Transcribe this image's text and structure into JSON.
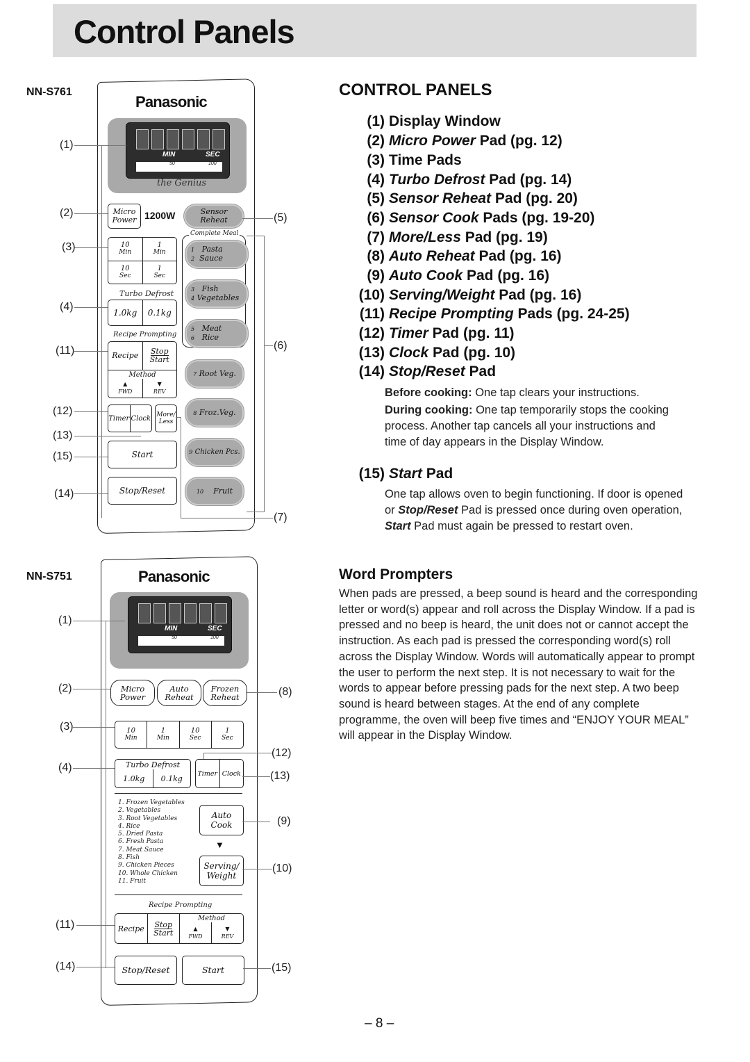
{
  "page": {
    "title": "Control Panels",
    "page_number": "– 8 –"
  },
  "panel_s761": {
    "model": "NN-S761",
    "brand": "Panasonic",
    "display": {
      "min_label": "MIN",
      "sec_label": "SEC",
      "pct_50": "50",
      "pct_100": "100",
      "pct_sign": "%",
      "logo": "the Genius"
    },
    "micro_power": [
      "Micro",
      "Power"
    ],
    "wattage": "1200W",
    "sensor_reheat": [
      "Sensor",
      "Reheat"
    ],
    "complete_meal_label": "Complete Meal",
    "time_pads": [
      [
        "10",
        "Min"
      ],
      [
        "1",
        "Min"
      ],
      [
        "10",
        "Sec"
      ],
      [
        "1",
        "Sec"
      ]
    ],
    "turbo_defrost_label": "Turbo Defrost",
    "turbo_defrost": [
      "1.0kg",
      "0.1kg"
    ],
    "recipe_prompting_label": "Recipe Prompting",
    "recipe": "Recipe",
    "stop": "Stop",
    "start_small": "Start",
    "method": "Method",
    "fwd": "FWD",
    "rev": "REV",
    "timer": "Timer",
    "clock": "Clock",
    "more_less": [
      "More/",
      "Less"
    ],
    "start": "Start",
    "stop_reset": "Stop/Reset",
    "sensor_cook_pads": [
      {
        "n1": "1",
        "l1": "Pasta",
        "n2": "2",
        "l2": "Sauce"
      },
      {
        "n1": "3",
        "l1": "Fish",
        "n2": "4",
        "l2": "Vegetables"
      },
      {
        "n1": "5",
        "l1": "Meat",
        "n2": "6",
        "l2": "Rice"
      },
      {
        "n1": "7",
        "l1": "Root Veg."
      },
      {
        "n1": "8",
        "l1": "Froz.Veg."
      },
      {
        "n1": "9",
        "l1": "Chicken Pcs."
      },
      {
        "n1": "10",
        "l1": "Fruit"
      }
    ],
    "callouts_left": [
      "(1)",
      "(2)",
      "(3)",
      "(4)",
      "(11)",
      "(12)",
      "(13)",
      "(15)",
      "(14)"
    ],
    "callouts_right": [
      "(5)",
      "(6)",
      "(7)"
    ]
  },
  "panel_s751": {
    "model": "NN-S751",
    "brand": "Panasonic",
    "display": {
      "min_label": "MIN",
      "sec_label": "SEC",
      "pct_50": "50",
      "pct_100": "100",
      "pct_sign": "%"
    },
    "top_pads": [
      [
        "Micro",
        "Power"
      ],
      [
        "Auto",
        "Reheat"
      ],
      [
        "Frozen",
        "Reheat"
      ]
    ],
    "time_pads": [
      [
        "10",
        "Min"
      ],
      [
        "1",
        "Min"
      ],
      [
        "10",
        "Sec"
      ],
      [
        "1",
        "Sec"
      ]
    ],
    "turbo_defrost_label": "Turbo Defrost",
    "turbo_defrost": [
      "1.0kg",
      "0.1kg"
    ],
    "timer": "Timer",
    "clock": "Clock",
    "auto_cook_list": [
      "1. Frozen Vegetables",
      "2. Vegetables",
      "3. Root Vegetables",
      "4. Rice",
      "5. Dried Pasta",
      "6. Fresh Pasta",
      "7. Meat Sauce",
      "8. Fish",
      "9. Chicken Pieces",
      "10. Whole Chicken",
      "11. Fruit"
    ],
    "auto_cook": [
      "Auto",
      "Cook"
    ],
    "serving_weight": [
      "Serving/",
      "Weight"
    ],
    "recipe_prompting_label": "Recipe Prompting",
    "recipe": "Recipe",
    "stop": "Stop",
    "start_small": "Start",
    "method": "Method",
    "fwd": "FWD",
    "rev": "REV",
    "stop_reset": "Stop/Reset",
    "start": "Start",
    "callouts_left": [
      "(1)",
      "(2)",
      "(3)",
      "(4)",
      "(11)",
      "(14)"
    ],
    "callouts_right": [
      "(8)",
      "(12)",
      "(13)",
      "(9)",
      "(10)",
      "(15)"
    ]
  },
  "control_panels": {
    "heading": "CONTROL PANELS",
    "items": [
      {
        "num": "(1)",
        "italic": "",
        "rest": "Display Window"
      },
      {
        "num": "(2)",
        "italic": "Micro Power",
        "rest": " Pad (pg. 12)"
      },
      {
        "num": "(3)",
        "italic": "",
        "rest": "Time Pads"
      },
      {
        "num": "(4)",
        "italic": "Turbo Defrost",
        "rest": " Pad (pg. 14)"
      },
      {
        "num": "(5)",
        "italic": "Sensor Reheat",
        "rest": " Pad (pg. 20)"
      },
      {
        "num": "(6)",
        "italic": "Sensor Cook",
        "rest": " Pads (pg. 19-20)"
      },
      {
        "num": "(7)",
        "italic": "More/Less",
        "rest": " Pad (pg. 19)"
      },
      {
        "num": "(8)",
        "italic": "Auto Reheat",
        "rest": " Pad (pg. 16)"
      },
      {
        "num": "(9)",
        "italic": "Auto Cook",
        "rest": " Pad (pg. 16)"
      },
      {
        "num": "(10)",
        "italic": "Serving/Weight",
        "rest": " Pad (pg. 16)"
      },
      {
        "num": "(11)",
        "italic": "Recipe Prompting",
        "rest": " Pads (pg. 24-25)"
      },
      {
        "num": "(12)",
        "italic": "Timer",
        "rest": " Pad (pg. 11)"
      },
      {
        "num": "(13)",
        "italic": "Clock",
        "rest": " Pad (pg. 10)"
      },
      {
        "num": "(14)",
        "italic": "Stop/Reset",
        "rest": " Pad"
      }
    ],
    "stop_reset_desc": {
      "before_label": "Before cooking:",
      "before_text": " One tap clears your instructions.",
      "during_label": "During cooking:",
      "during_text": " One tap temporarily stops the cooking process. Another tap cancels all your instructions and time of day appears in the Display Window."
    },
    "start_item": {
      "num": "(15)",
      "italic": "Start",
      "rest": " Pad"
    },
    "start_desc": {
      "p1": "One tap allows oven to begin functioning. If door is opened or ",
      "b1": "Stop/Reset",
      "p2": " Pad is pressed once during oven operation, ",
      "b2": "Start",
      "p3": " Pad must again be pressed to restart oven."
    }
  },
  "word_prompters": {
    "heading": "Word Prompters",
    "text": "When pads are pressed, a beep sound is heard and the corresponding letter or word(s) appear and roll across the Display Window. If a pad is pressed and no beep is heard, the unit does not or cannot accept the instruction. As each pad is pressed the corresponding word(s) roll across the Display Window. Words will automatically appear to prompt the user to perform the next step. It is not necessary to wait for the words to appear before pressing pads for the next step. A two beep sound is heard between stages. At the end of any complete programme, the oven will beep five times and “ENJOY YOUR MEAL” will appear in the Display Window."
  }
}
